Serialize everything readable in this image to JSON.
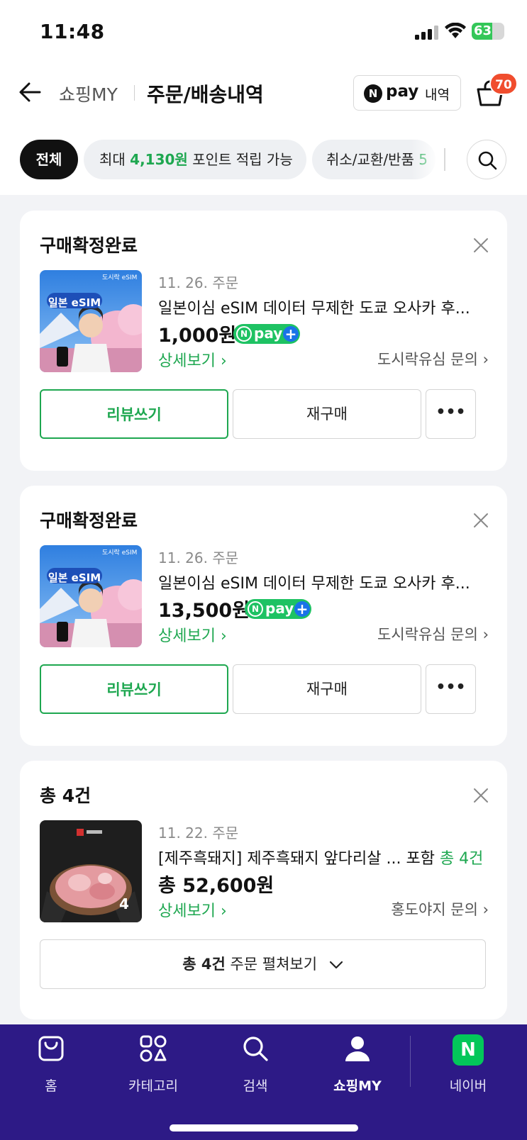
{
  "status_bar": {
    "time": "11:48",
    "battery": "63",
    "battery_level_pct": 63
  },
  "header": {
    "crumb": "쇼핑MY",
    "title": "주문/배송내역",
    "npay_n": "N",
    "npay_pay": "pay",
    "npay_label": "내역",
    "cart_count": "70"
  },
  "filters": {
    "all": "전체",
    "points_prefix": "최대 ",
    "points_amount": "4,130원",
    "points_suffix": " 포인트 적립 가능",
    "cancel_label": "취소/교환/반품 ",
    "cancel_count": "5"
  },
  "orders": [
    {
      "status": "구매확정완료",
      "date": "11. 26. 주문",
      "product": "일본이심 eSIM 데이터 무제한 도쿄 오사카 후...",
      "price": "1,000원",
      "detail": "상세보기 ›",
      "inquiry": "도시락유심 문의 ›",
      "thumb_brand": "도시락 eSIM",
      "thumb_title": "일본 eSIM",
      "review": "리뷰쓰기",
      "rebuy": "재구매",
      "more": "•••"
    },
    {
      "status": "구매확정완료",
      "date": "11. 26. 주문",
      "product": "일본이심 eSIM 데이터 무제한 도쿄 오사카 후...",
      "price": "13,500원",
      "detail": "상세보기 ›",
      "inquiry": "도시락유심 문의 ›",
      "thumb_brand": "도시락 eSIM",
      "thumb_title": "일본 eSIM",
      "review": "리뷰쓰기",
      "rebuy": "재구매",
      "more": "•••"
    },
    {
      "status": "총 4건",
      "date": "11. 22. 주문",
      "product_main": "[제주흑돼지] 제주흑돼지 앞다리살 ... 포함 ",
      "product_count": "총 4건",
      "price": "총 52,600원",
      "detail": "상세보기 ›",
      "inquiry": "홍도야지 문의 ›",
      "thumb_count": "4",
      "expand_bold": "총 4건",
      "expand_rest": " 주문 펼쳐보기"
    }
  ],
  "npay_badge": {
    "n": "N",
    "pay": "pay",
    "plus": "+"
  },
  "tabbar": {
    "home": "홈",
    "category": "카테고리",
    "search": "검색",
    "my": "쇼핑MY",
    "naver": "네이버",
    "naver_n": "N"
  },
  "colors": {
    "accent_green": "#1ea750",
    "tabbar_bg": "#2d1a86",
    "badge_red": "#f04d2e"
  }
}
